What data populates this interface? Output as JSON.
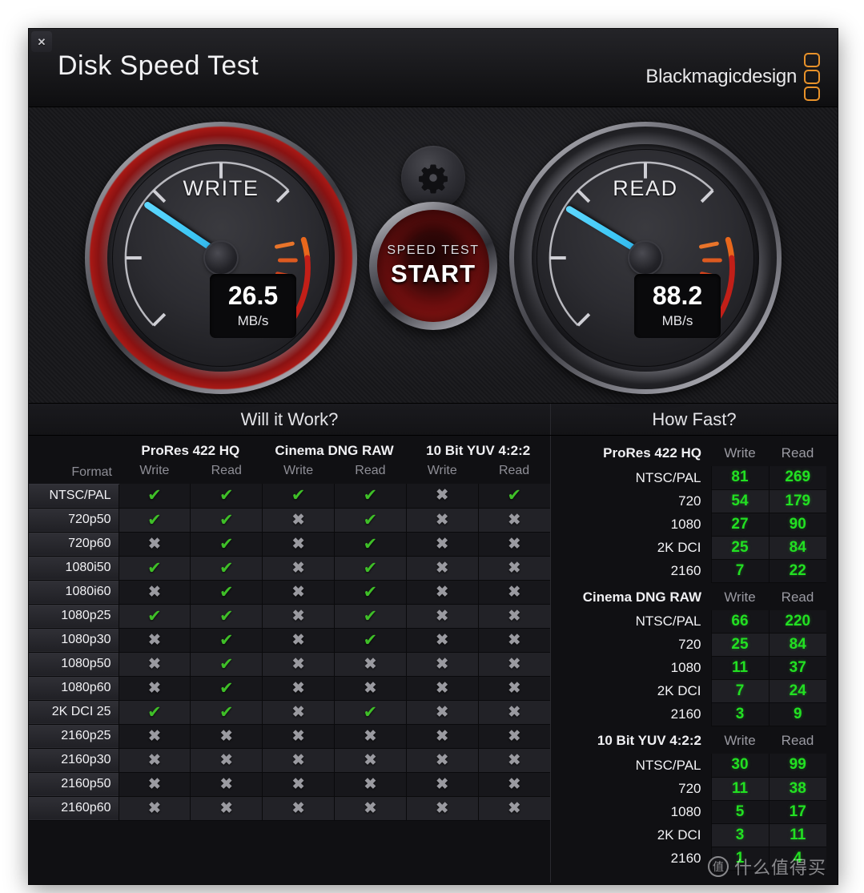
{
  "window": {
    "title": "Disk Speed Test",
    "close_label": "✕",
    "brand_text": "Blackmagicdesign"
  },
  "gauges": {
    "write": {
      "label": "WRITE",
      "value": "26.5",
      "unit": "MB/s",
      "needle_deg": 214
    },
    "read": {
      "label": "READ",
      "value": "88.2",
      "unit": "MB/s",
      "needle_deg": 211
    }
  },
  "controls": {
    "gear_icon": "gear-icon",
    "start_sub": "SPEED TEST",
    "start_main": "START"
  },
  "sections": {
    "left_header": "Will it Work?",
    "right_header": "How Fast?"
  },
  "compat": {
    "format_header": "Format",
    "groups": [
      "ProRes 422 HQ",
      "Cinema DNG RAW",
      "10 Bit YUV 4:2:2"
    ],
    "sub_headers": [
      "Write",
      "Read",
      "Write",
      "Read",
      "Write",
      "Read"
    ],
    "rows": [
      {
        "format": "NTSC/PAL",
        "cells": [
          true,
          true,
          true,
          true,
          false,
          true
        ]
      },
      {
        "format": "720p50",
        "cells": [
          true,
          true,
          false,
          true,
          false,
          false
        ]
      },
      {
        "format": "720p60",
        "cells": [
          false,
          true,
          false,
          true,
          false,
          false
        ]
      },
      {
        "format": "1080i50",
        "cells": [
          true,
          true,
          false,
          true,
          false,
          false
        ]
      },
      {
        "format": "1080i60",
        "cells": [
          false,
          true,
          false,
          true,
          false,
          false
        ]
      },
      {
        "format": "1080p25",
        "cells": [
          true,
          true,
          false,
          true,
          false,
          false
        ]
      },
      {
        "format": "1080p30",
        "cells": [
          false,
          true,
          false,
          true,
          false,
          false
        ]
      },
      {
        "format": "1080p50",
        "cells": [
          false,
          true,
          false,
          false,
          false,
          false
        ]
      },
      {
        "format": "1080p60",
        "cells": [
          false,
          true,
          false,
          false,
          false,
          false
        ]
      },
      {
        "format": "2K DCI 25",
        "cells": [
          true,
          true,
          false,
          true,
          false,
          false
        ]
      },
      {
        "format": "2160p25",
        "cells": [
          false,
          false,
          false,
          false,
          false,
          false
        ]
      },
      {
        "format": "2160p30",
        "cells": [
          false,
          false,
          false,
          false,
          false,
          false
        ]
      },
      {
        "format": "2160p50",
        "cells": [
          false,
          false,
          false,
          false,
          false,
          false
        ]
      },
      {
        "format": "2160p60",
        "cells": [
          false,
          false,
          false,
          false,
          false,
          false
        ]
      }
    ],
    "ok_glyph": "✔",
    "no_glyph": "✖"
  },
  "speed": {
    "write_header": "Write",
    "read_header": "Read",
    "blocks": [
      {
        "group": "ProRes 422 HQ",
        "rows": [
          {
            "label": "NTSC/PAL",
            "write": "81",
            "read": "269"
          },
          {
            "label": "720",
            "write": "54",
            "read": "179"
          },
          {
            "label": "1080",
            "write": "27",
            "read": "90"
          },
          {
            "label": "2K DCI",
            "write": "25",
            "read": "84"
          },
          {
            "label": "2160",
            "write": "7",
            "read": "22"
          }
        ]
      },
      {
        "group": "Cinema DNG RAW",
        "rows": [
          {
            "label": "NTSC/PAL",
            "write": "66",
            "read": "220"
          },
          {
            "label": "720",
            "write": "25",
            "read": "84"
          },
          {
            "label": "1080",
            "write": "11",
            "read": "37"
          },
          {
            "label": "2K DCI",
            "write": "7",
            "read": "24"
          },
          {
            "label": "2160",
            "write": "3",
            "read": "9"
          }
        ]
      },
      {
        "group": "10 Bit YUV 4:2:2",
        "rows": [
          {
            "label": "NTSC/PAL",
            "write": "30",
            "read": "99"
          },
          {
            "label": "720",
            "write": "11",
            "read": "38"
          },
          {
            "label": "1080",
            "write": "5",
            "read": "17"
          },
          {
            "label": "2K DCI",
            "write": "3",
            "read": "11"
          },
          {
            "label": "2160",
            "write": "1",
            "read": "4"
          }
        ]
      }
    ]
  },
  "watermark": {
    "badge": "值",
    "text": "什么值得买"
  },
  "colors": {
    "accent_orange": "#e8922a",
    "needle_blue": "#3dc7f5",
    "ok_green": "#3fbf28",
    "value_green": "#22e022",
    "start_red": "#c2201a"
  }
}
